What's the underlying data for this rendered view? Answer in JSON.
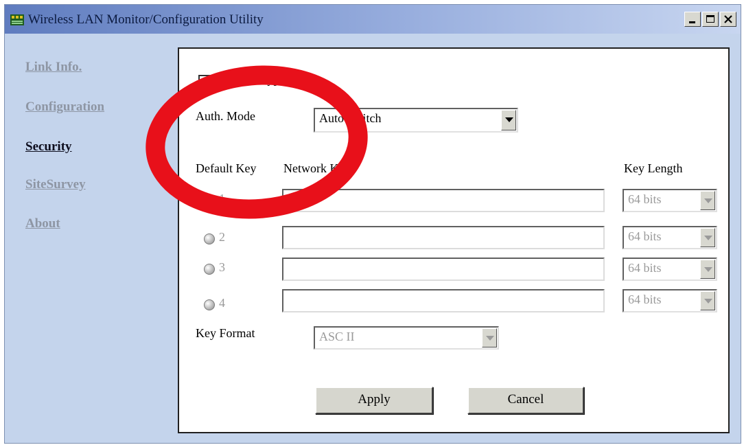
{
  "window": {
    "title": "Wireless LAN Monitor/Configuration Utility",
    "controls": [
      "minimize-icon",
      "maximize-icon",
      "close-icon"
    ]
  },
  "sidebar": {
    "items": [
      {
        "label": "Link Info.",
        "active": false
      },
      {
        "label": "Configuration",
        "active": false
      },
      {
        "label": "Security",
        "active": true
      },
      {
        "label": "SiteSurvey",
        "active": false
      },
      {
        "label": "About",
        "active": false
      }
    ]
  },
  "security": {
    "encryption_label": "Data Encryption",
    "encryption_checked": false,
    "auth_mode_label": "Auth. Mode",
    "auth_mode_value": "Auto Switch",
    "default_key_header": "Default Key",
    "network_key_header": "Network Key",
    "key_length_header": "Key Length",
    "keys": [
      {
        "index": "1",
        "value": "",
        "length": "64 bits",
        "selected": true
      },
      {
        "index": "2",
        "value": "",
        "length": "64 bits",
        "selected": false
      },
      {
        "index": "3",
        "value": "",
        "length": "64 bits",
        "selected": false
      },
      {
        "index": "4",
        "value": "",
        "length": "64 bits",
        "selected": false
      }
    ],
    "key_format_label": "Key Format",
    "key_format_value": "ASC II",
    "apply_label": "Apply",
    "cancel_label": "Cancel"
  },
  "colors": {
    "window_bg": "#c4d4ec",
    "annotation_red": "#e8101a",
    "nav_active": "#0e0e1e",
    "nav_inactive": "#8e96a4"
  }
}
